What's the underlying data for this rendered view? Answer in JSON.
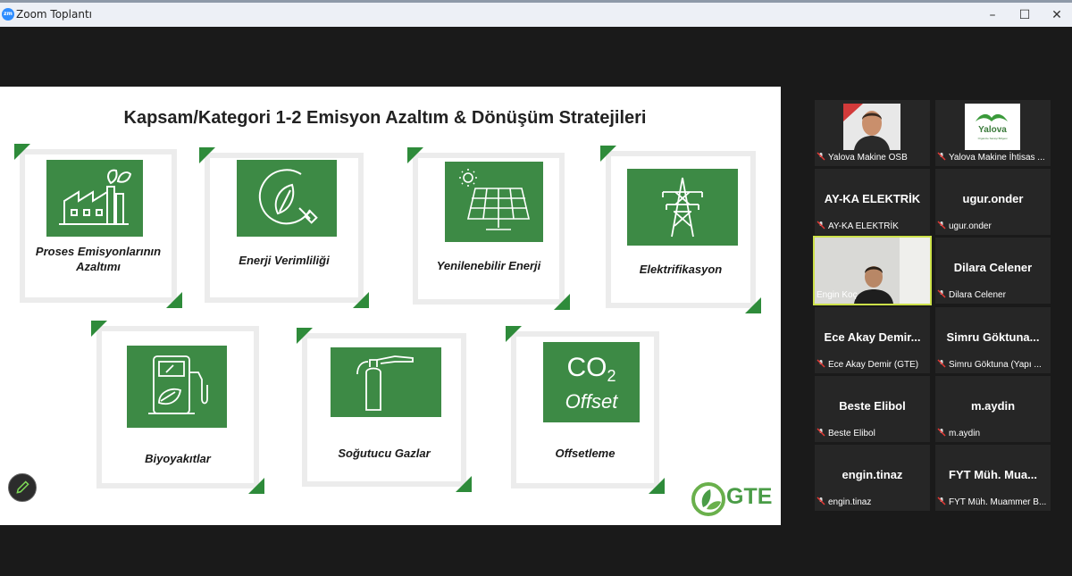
{
  "window": {
    "app_logo": "zm",
    "title": "Zoom Toplantı",
    "controls": [
      "–",
      "☐",
      "✕"
    ]
  },
  "slide": {
    "title": "Kapsam/Kategori 1-2 Emisyon Azaltım & Dönüşüm Stratejileri",
    "cards": [
      {
        "label_lines": [
          "Proses Emisyonlarının",
          "Azaltımı"
        ],
        "icon": "factory-leaf-icon"
      },
      {
        "label_lines": [
          "Enerji Verimliliği"
        ],
        "icon": "energy-leaf-plug-icon"
      },
      {
        "label_lines": [
          "Yenilenebilir Enerji"
        ],
        "icon": "solar-panel-icon"
      },
      {
        "label_lines": [
          "Elektrifikasyon"
        ],
        "icon": "power-tower-icon"
      },
      {
        "label_lines": [
          "Biyoyakıtlar"
        ],
        "icon": "fuel-pump-leaf-icon"
      },
      {
        "label_lines": [
          "Soğutucu Gazlar"
        ],
        "icon": "fire-extinguisher-icon"
      },
      {
        "label_lines": [
          "Offsetleme"
        ],
        "icon": "co2-offset-icon",
        "icon_text": [
          "CO",
          "2",
          "Offset"
        ]
      }
    ],
    "logo_text": "GTE",
    "colors": {
      "green": "#3d8a45",
      "accent": "#2e8b3a"
    }
  },
  "participants": [
    {
      "name": "",
      "label": "Yalova Makine OSB",
      "video": "person-photo"
    },
    {
      "name": "",
      "label": "Yalova Makine İhtisas ...",
      "video": "yalova-logo",
      "logo_text": [
        "Yalova",
        "Organize Sanayi Bölgesi"
      ]
    },
    {
      "name": "AY-KA ELEKTRİK",
      "label": "AY-KA ELEKTRİK"
    },
    {
      "name": "ugur.onder",
      "label": "ugur.onder"
    },
    {
      "name": "",
      "label": "Engin Koç",
      "video": "person-camera",
      "active": true
    },
    {
      "name": "Dilara Celener",
      "label": "Dilara Celener"
    },
    {
      "name": "Ece Akay Demir...",
      "label": "Ece Akay Demir (GTE)"
    },
    {
      "name": "Simru Göktuna...",
      "label": "Simru Göktuna (Yapı ..."
    },
    {
      "name": "Beste Elibol",
      "label": "Beste Elibol"
    },
    {
      "name": "m.aydin",
      "label": "m.aydin"
    },
    {
      "name": "engin.tinaz",
      "label": "engin.tinaz"
    },
    {
      "name": "FYT Müh. Mua...",
      "label": "FYT Müh. Muammer B..."
    }
  ]
}
